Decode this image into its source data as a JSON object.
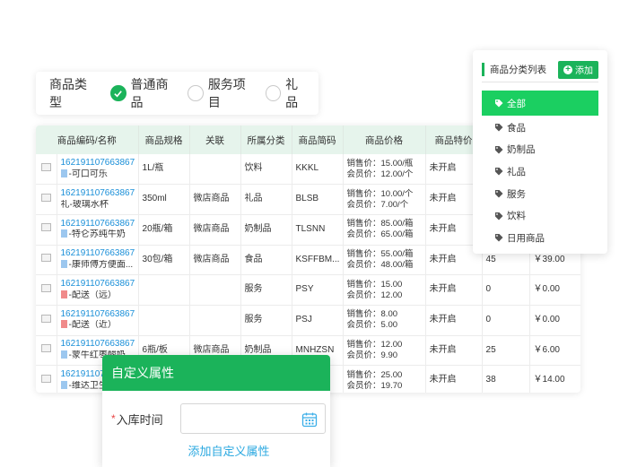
{
  "product_type": {
    "label": "商品类型",
    "options": [
      {
        "label": "普通商品",
        "checked": true
      },
      {
        "label": "服务项目",
        "checked": false
      },
      {
        "label": "礼品",
        "checked": false
      }
    ]
  },
  "table": {
    "headers": [
      "商品编码/名称",
      "商品规格",
      "关联",
      "所属分类",
      "商品简码",
      "商品价格",
      "商品特价",
      "",
      ""
    ],
    "rows": [
      {
        "code": "16219110766386​7",
        "tag": "blue",
        "name": "-可口可乐",
        "spec": "1L/瓶",
        "link": "",
        "category": "饮料",
        "short": "KKKL",
        "sale": "销售价：15.00/瓶",
        "member": "会员价：12.00/个",
        "special": "未开启",
        "stock": "",
        "amount": ""
      },
      {
        "code": "162191107663867",
        "tag": "",
        "name": "礼-玻璃水杯",
        "spec": "350ml",
        "link": "微店商品",
        "category": "礼品",
        "short": "BLSB",
        "sale": "销售价：10.00/个",
        "member": "会员价：7.00/个",
        "special": "未开启",
        "stock": "",
        "amount": ""
      },
      {
        "code": "162191107663867",
        "tag": "blue",
        "name": "-特仑苏纯牛奶",
        "spec": "20瓶/箱",
        "link": "微店商品",
        "category": "奶制品",
        "short": "TLSNN",
        "sale": "销售价：85.00/箱",
        "member": "会员价：65.00/箱",
        "special": "未开启",
        "stock": "",
        "amount": ""
      },
      {
        "code": "162191107663867",
        "tag": "blue",
        "name": "-康师傅方便面...",
        "spec": "30包/箱",
        "link": "微店商品",
        "category": "食品",
        "short": "KSFFBM...",
        "sale": "销售价：55.00/箱",
        "member": "会员价：48.00/箱",
        "special": "未开启",
        "stock": "45",
        "amount": "￥39.00"
      },
      {
        "code": "162191107663867",
        "tag": "red",
        "name": "-配送（远）",
        "spec": "",
        "link": "",
        "category": "服务",
        "short": "PSY",
        "sale": "销售价：15.00",
        "member": "会员价：12.00",
        "special": "未开启",
        "stock": "0",
        "amount": "￥0.00"
      },
      {
        "code": "162191107663867",
        "tag": "red",
        "name": "-配送（近）",
        "spec": "",
        "link": "",
        "category": "服务",
        "short": "PSJ",
        "sale": "销售价：8.00",
        "member": "会员价：5.00",
        "special": "未开启",
        "stock": "0",
        "amount": "￥0.00"
      },
      {
        "code": "162191107663867",
        "tag": "blue",
        "name": "-蒙牛红枣酸奶",
        "spec": "6瓶/板",
        "link": "微店商品",
        "category": "奶制品",
        "short": "MNHZSN",
        "sale": "销售价：12.00",
        "member": "会员价：9.90",
        "special": "未开启",
        "stock": "25",
        "amount": "￥6.00"
      },
      {
        "code": "162191107",
        "tag": "blue",
        "name": "-维达卫生...",
        "spec": "",
        "link": "",
        "category": "",
        "short": "",
        "sale": "销售价：25.00",
        "member": "会员价：19.70",
        "special": "未开启",
        "stock": "38",
        "amount": "￥14.00"
      }
    ]
  },
  "category_panel": {
    "title": "商品分类列表",
    "add_label": "添加",
    "items": [
      {
        "label": "全部",
        "active": true
      },
      {
        "label": "食品",
        "active": false
      },
      {
        "label": "奶制品",
        "active": false
      },
      {
        "label": "礼品",
        "active": false
      },
      {
        "label": "服务",
        "active": false
      },
      {
        "label": "饮料",
        "active": false
      },
      {
        "label": "日用商品",
        "active": false
      }
    ]
  },
  "dialog": {
    "title": "自定义属性",
    "required_mark": "*",
    "field_label": "入库时间",
    "date_value": "",
    "add_link": "添加自定义属性"
  },
  "colors": {
    "accent": "#1bb35a",
    "link": "#1a8fd8"
  }
}
